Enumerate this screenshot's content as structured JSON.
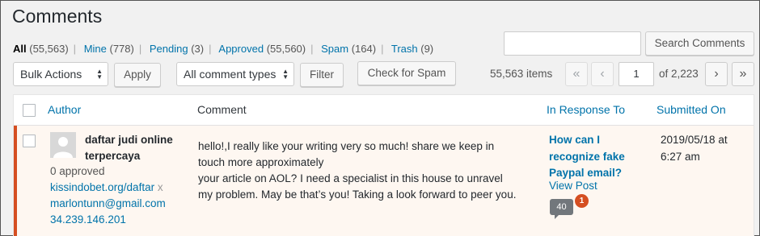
{
  "header": {
    "title": "Comments"
  },
  "filters": [
    {
      "label": "All",
      "count": "(55,563)",
      "current": true
    },
    {
      "label": "Mine",
      "count": "(778)"
    },
    {
      "label": "Pending",
      "count": "(3)"
    },
    {
      "label": "Approved",
      "count": "(55,560)"
    },
    {
      "label": "Spam",
      "count": "(164)"
    },
    {
      "label": "Trash",
      "count": "(9)"
    }
  ],
  "search": {
    "value": "",
    "button_label": "Search Comments"
  },
  "actions": {
    "bulk_select": "Bulk Actions",
    "apply_label": "Apply",
    "type_select": "All comment types",
    "filter_label": "Filter",
    "check_spam_label": "Check for Spam"
  },
  "pagination": {
    "items_text": "55,563 items",
    "first": "«",
    "prev": "‹",
    "current_page": "1",
    "of_text": "of 2,223",
    "next": "›",
    "last": "»"
  },
  "table": {
    "columns": {
      "author": "Author",
      "comment": "Comment",
      "response": "In Response To",
      "submitted": "Submitted On"
    },
    "rows": [
      {
        "author_name": "daftar judi online terpercaya",
        "approved": "0 approved",
        "url": "kissindobet.org/daftar",
        "url_x": " x",
        "email": "marlontunn@gmail.com",
        "ip": "34.239.146.201",
        "comment_lines": [
          "hello!,I really like your writing very so much! share we keep in",
          "touch more approximately",
          "your article on AOL? I need a specialist in this house to unravel",
          "my problem. May be that’s you! Taking a look forward to peer you."
        ],
        "response_title": "How can I recognize fake Paypal email?",
        "view_post": "View Post",
        "comment_count": "40",
        "pending_count": "1",
        "submitted": "2019/05/18 at 6:27 am"
      }
    ]
  },
  "colors": {
    "link": "#0073aa",
    "unapproved_border": "#d54e21",
    "unapproved_bg": "#fef7f1"
  }
}
